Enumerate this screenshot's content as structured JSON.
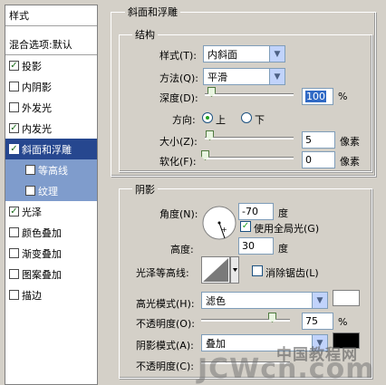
{
  "left_panel": {
    "header": "样式",
    "blend_options": "混合选项:默认",
    "items": [
      {
        "label": "投影",
        "checked": true
      },
      {
        "label": "内阴影",
        "checked": false
      },
      {
        "label": "外发光",
        "checked": false
      },
      {
        "label": "内发光",
        "checked": true
      },
      {
        "label": "斜面和浮雕",
        "checked": true,
        "selected": true
      },
      {
        "label": "等高线",
        "checked": false,
        "sub": true
      },
      {
        "label": "纹理",
        "checked": false,
        "sub": true
      },
      {
        "label": "光泽",
        "checked": true
      },
      {
        "label": "颜色叠加",
        "checked": false
      },
      {
        "label": "渐变叠加",
        "checked": false
      },
      {
        "label": "图案叠加",
        "checked": false
      },
      {
        "label": "描边",
        "checked": false
      }
    ]
  },
  "bevel": {
    "section_title": "斜面和浮雕",
    "structure": {
      "title": "结构",
      "style_label": "样式(T):",
      "style_value": "内斜面",
      "technique_label": "方法(Q):",
      "technique_value": "平滑",
      "depth_label": "深度(D):",
      "depth_value": "100",
      "depth_unit": "%",
      "direction_label": "方向:",
      "direction_up": "上",
      "direction_down": "下",
      "size_label": "大小(Z):",
      "size_value": "5",
      "size_unit": "像素",
      "soften_label": "软化(F):",
      "soften_value": "0",
      "soften_unit": "像素"
    },
    "shading": {
      "title": "阴影",
      "angle_label": "角度(N):",
      "angle_value": "-70",
      "angle_unit": "度",
      "global_light_label": "使用全局光(G)",
      "global_light_checked": true,
      "altitude_label": "高度:",
      "altitude_value": "30",
      "altitude_unit": "度",
      "gloss_contour_label": "光泽等高线:",
      "anti_alias_label": "消除锯齿(L)",
      "anti_alias_checked": false,
      "highlight_mode_label": "高光模式(H):",
      "highlight_mode_value": "滤色",
      "highlight_color": "#ffffff",
      "highlight_opacity_label": "不透明度(O):",
      "highlight_opacity_value": "75",
      "opacity_unit": "%",
      "shadow_mode_label": "阴影模式(A):",
      "shadow_mode_value": "叠加",
      "shadow_opacity_label": "不透明度(C):"
    }
  },
  "watermark": {
    "line1": "中国教程网",
    "line2": "JCWcn.com"
  },
  "colors": {
    "selected_row": "#26478f",
    "sub_row": "#7f9ccc",
    "panel_bg": "#d4d0c8"
  }
}
